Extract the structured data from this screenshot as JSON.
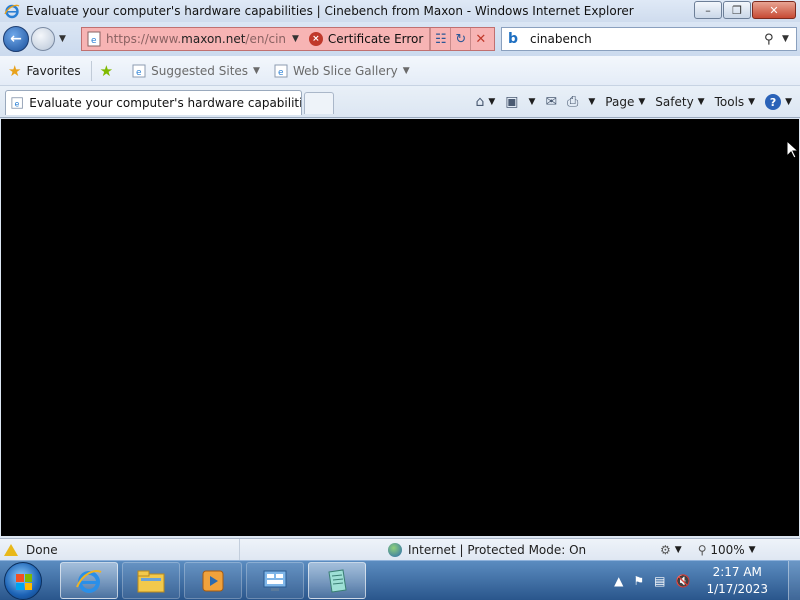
{
  "window": {
    "title": "Evaluate your computer's hardware capabilities | Cinebench from Maxon - Windows Internet Explorer"
  },
  "address_bar": {
    "url_prefix": "https://www.",
    "url_host": "maxon.net",
    "url_suffix": "/en/cineb",
    "certificate_label": "Certificate Error"
  },
  "search": {
    "value": "cinabench",
    "provider_icon": "bing-icon"
  },
  "favorites_bar": {
    "favorites_label": "Favorites",
    "suggested_sites_label": "Suggested Sites",
    "web_slice_label": "Web Slice Gallery"
  },
  "tabs": [
    {
      "label": "Evaluate your computer's hardware capabilities | ..."
    }
  ],
  "command_bar": {
    "page_label": "Page",
    "safety_label": "Safety",
    "tools_label": "Tools"
  },
  "status_bar": {
    "status_text": "Done",
    "zone_text": "Internet | Protected Mode: On",
    "zoom_label": "100%"
  },
  "taskbar": {
    "time": "2:17 AM",
    "date": "1/17/2023"
  },
  "colors": {
    "address_error_bg": "#f7b4b4",
    "content_bg": "#000000",
    "taskbar": "#2a568c"
  }
}
